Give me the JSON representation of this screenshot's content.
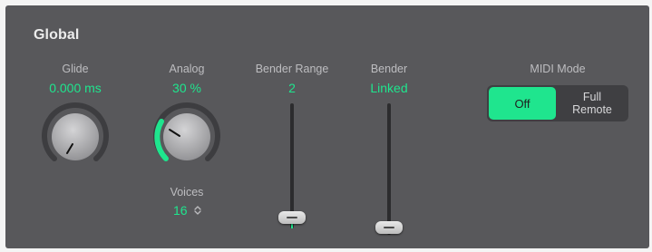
{
  "section": {
    "title": "Global"
  },
  "glide": {
    "label": "Glide",
    "value": "0.000 ms",
    "level": 0.0
  },
  "analog": {
    "label": "Analog",
    "value": "30 %",
    "level": 0.3
  },
  "voices": {
    "label": "Voices",
    "value": "16",
    "icon": "up-down-stepper-icon"
  },
  "bender_range": {
    "label": "Bender Range",
    "value": "2",
    "level": 0.02
  },
  "bender": {
    "label": "Bender",
    "value": "Linked",
    "level": 0.0
  },
  "midi_mode": {
    "label": "MIDI Mode",
    "options": [
      "Off",
      "Full",
      "Remote"
    ],
    "selected": "Off"
  },
  "colors": {
    "accent": "#1fe58e",
    "panel": "#58585b",
    "label": "#bdbdc0"
  }
}
